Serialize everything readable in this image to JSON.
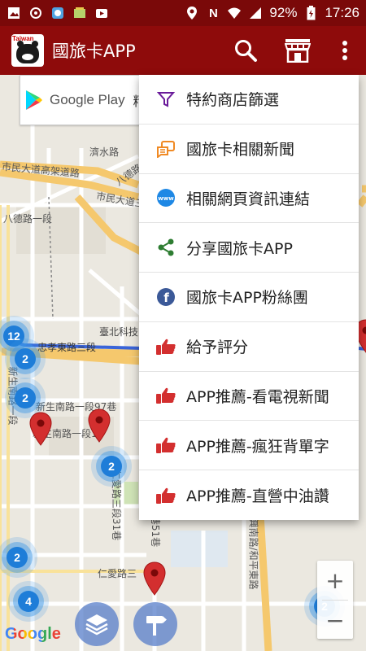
{
  "status_bar": {
    "battery": "92%",
    "time": "17:26",
    "icons": [
      "image-icon",
      "sync-icon",
      "app-icon",
      "gallery-icon",
      "play-icon",
      "location-icon",
      "nfc-icon",
      "wifi-icon",
      "signal-icon",
      "battery-icon"
    ]
  },
  "app_bar": {
    "logo_text": "Taiwan",
    "title": "國旅卡APP",
    "actions": [
      "search-icon",
      "store-icon",
      "overflow-menu-icon"
    ]
  },
  "ad": {
    "text": "Google Play",
    "extra": "精"
  },
  "menu": {
    "items": [
      {
        "label": "特約商店篩選",
        "icon": "filter-icon"
      },
      {
        "label": "國旅卡相關新聞",
        "icon": "chat-news-icon"
      },
      {
        "label": "相關網頁資訊連結",
        "icon": "www-icon"
      },
      {
        "label": "分享國旅卡APP",
        "icon": "share-icon"
      },
      {
        "label": "國旅卡APP粉絲團",
        "icon": "facebook-icon"
      },
      {
        "label": "給予評分",
        "icon": "thumbs-up-icon"
      },
      {
        "label": "APP推薦-看電視新聞",
        "icon": "thumbs-up-icon"
      },
      {
        "label": "APP推薦-瘋狂背單字",
        "icon": "thumbs-up-icon"
      },
      {
        "label": "APP推薦-直營中油讚",
        "icon": "thumbs-up-icon"
      }
    ]
  },
  "map": {
    "streets": {
      "s1": "市民大道高架道路",
      "s2": "濟水路",
      "s3": "八德路",
      "s4": "市民大道三段",
      "s5": "八德路一段",
      "s6": "忠孝東路三段",
      "s7": "臺北科技",
      "s8": "新生南路一段",
      "s9": "新生南路一段97巷",
      "s10": "新生南路一段10",
      "s11": "仁愛路三段31巷",
      "s12": "仁愛路三",
      "s13": "巷51巷",
      "s14": "復興南路/和平東路"
    },
    "clusters": [
      "12",
      "2",
      "2",
      "2",
      "2",
      "4",
      "2"
    ],
    "zoom_in": "+",
    "zoom_out": "−",
    "google_logo": "Google"
  },
  "colors": {
    "status_bar": "#7a0909",
    "app_bar": "#8e0b0b",
    "cluster": "#1e7dd8",
    "pin": "#d32f2f",
    "menu_red": "#d32f2f",
    "filter_purple": "#6a1b9a",
    "share_green": "#2e7d32",
    "facebook_blue": "#3b5998"
  }
}
